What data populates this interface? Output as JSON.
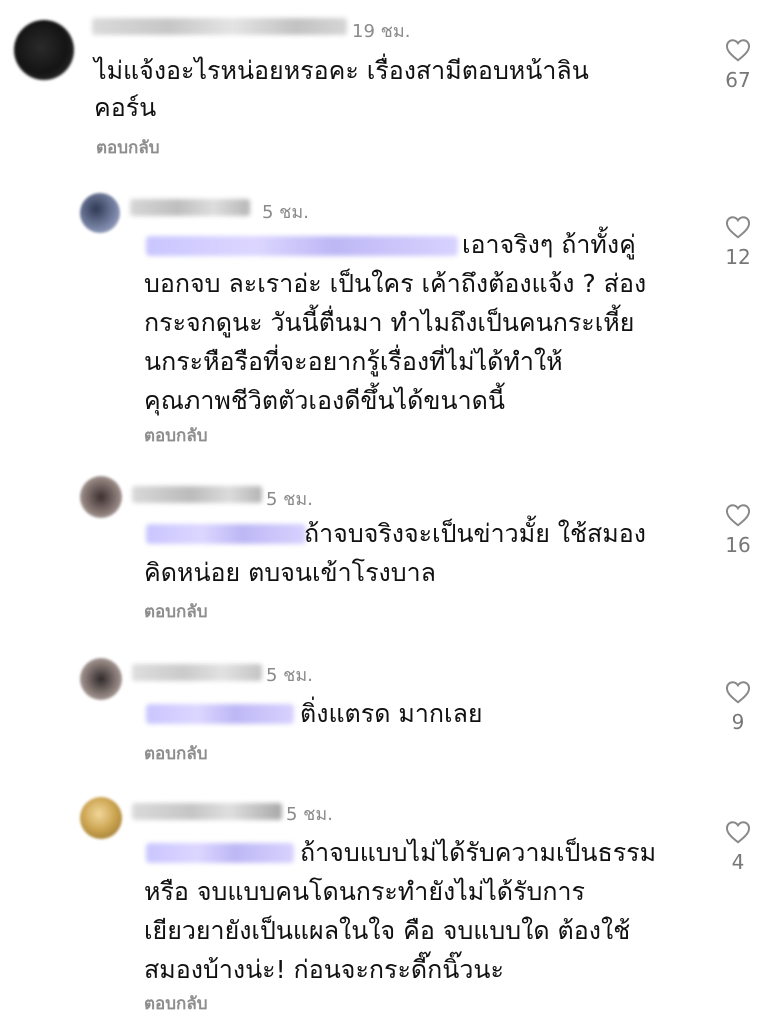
{
  "reply_label": "ตอบกลับ",
  "colors": {
    "text": "#111111",
    "meta": "#8a8a8a",
    "mention_blur": "#c9c6ff",
    "heart_outline": "#888888"
  },
  "comments": [
    {
      "time": "19 ชม.",
      "lines": [
        "ไม่แจ้งอะไรหน่อยหรอคะ เรื่องสามีตอบหน้าลิน",
        "คอร์น"
      ],
      "likes": "67",
      "icon": "heart-outline-icon"
    },
    {
      "time": "5 ชม.",
      "lines": [
        "เอาจริงๆ ถ้าทั้งคู่",
        "บอกจบ ละเราอ่ะ เป็นใคร เค้าถึงต้องแจ้ง ? ส่อง",
        "กระจกดูนะ วันนี้ตื่นมา ทำไมถึงเป็นคนกระเหี้ย",
        "นกระหือรือที่จะอยากรู้เรื่องที่ไม่ได้ทำให้",
        "คุณภาพชีวิตตัวเองดีขึ้นได้ขนาดนี้"
      ],
      "likes": "12",
      "icon": "heart-outline-icon"
    },
    {
      "time": "5 ชม.",
      "lines": [
        "ถ้าจบจริงจะเป็นข่าวมั้ย ใช้สมอง",
        "คิดหน่อย ตบจนเข้าโรงบาล"
      ],
      "likes": "16",
      "icon": "heart-outline-icon"
    },
    {
      "time": "5 ชม.",
      "lines": [
        "ติ่งแตรด มากเลย"
      ],
      "likes": "9",
      "icon": "heart-outline-icon"
    },
    {
      "time": "5 ชม.",
      "lines": [
        "ถ้าจบแบบไม่ได้รับความเป็นธรรม",
        "หรือ จบแบบคนโดนกระทำยังไม่ได้รับการ",
        "เยียวยายังเป็นแผลในใจ คือ จบแบบใด ต้องใช้",
        "สมองบ้างน่ะ! ก่อนจะกระดี๊กนิ๊วนะ"
      ],
      "likes": "4",
      "icon": "heart-outline-icon"
    }
  ]
}
